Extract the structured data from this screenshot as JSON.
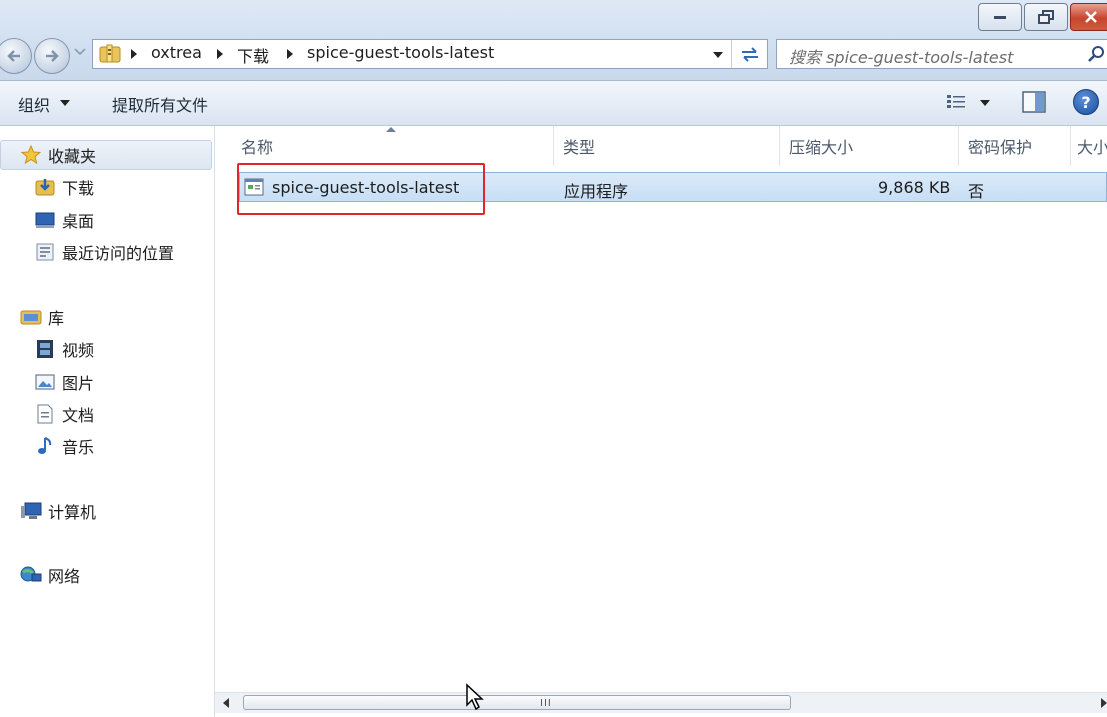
{
  "window": {
    "minimize_label": "—",
    "maximize_label": "❐",
    "close_label": "✕"
  },
  "address": {
    "crumbs": [
      "oxtrea",
      "下载",
      "spice-guest-tools-latest"
    ]
  },
  "search": {
    "placeholder": "搜索 spice-guest-tools-latest"
  },
  "toolbar": {
    "organize_label": "组织",
    "extract_label": "提取所有文件",
    "help_label": "?"
  },
  "sidebar": {
    "favorites": {
      "label": "收藏夹",
      "items": [
        {
          "label": "下载",
          "icon": "downloads-folder-icon"
        },
        {
          "label": "桌面",
          "icon": "desktop-icon"
        },
        {
          "label": "最近访问的位置",
          "icon": "recent-places-icon"
        }
      ]
    },
    "libraries": {
      "label": "库",
      "items": [
        {
          "label": "视频",
          "icon": "video-icon"
        },
        {
          "label": "图片",
          "icon": "pictures-icon"
        },
        {
          "label": "文档",
          "icon": "documents-icon"
        },
        {
          "label": "音乐",
          "icon": "music-icon"
        }
      ]
    },
    "computer": {
      "label": "计算机"
    },
    "network": {
      "label": "网络"
    }
  },
  "filelist": {
    "columns": [
      "名称",
      "类型",
      "压缩大小",
      "密码保护",
      "大小"
    ],
    "rows": [
      {
        "name": "spice-guest-tools-latest",
        "type": "应用程序",
        "compressed_size": "9,868 KB",
        "password": "否",
        "size": ""
      }
    ]
  },
  "scrollbar": {
    "grip": "III"
  },
  "colors": {
    "selection": "#cde2f7",
    "highlight_box": "#e0262a"
  }
}
